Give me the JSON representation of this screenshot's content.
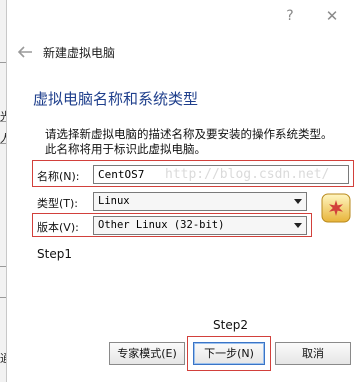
{
  "background_app": {
    "fragments": [
      "光",
      "人",
      "通"
    ]
  },
  "window": {
    "help_button": "?",
    "close_button": "✕"
  },
  "header": {
    "wizard_title": "新建虚拟电脑"
  },
  "page": {
    "title": "虚拟电脑名称和系统类型",
    "description_line1": "请选择新虚拟电脑的描述名称及要安装的操作系统类型。",
    "description_line2": "此名称将用于标识此虚拟电脑。"
  },
  "form": {
    "name_label": "名称(N):",
    "name_value": "CentOS7",
    "type_label": "类型(T):",
    "type_value": "Linux",
    "version_label": "版本(V):",
    "version_value": "Other Linux (32-bit)"
  },
  "watermark": "http://blog.csdn.net/",
  "annotations": {
    "step1": "Step1",
    "step2": "Step2",
    "highlight_color": "#d2403b"
  },
  "buttons": {
    "expert": "专家模式(E)",
    "next": "下一步(N)",
    "cancel": "取消"
  },
  "colors": {
    "title_blue": "#1f3f8c",
    "default_button_border": "#3a74c6"
  },
  "icons": {
    "back": "arrow-left-icon",
    "os": "linux-os-icon"
  }
}
